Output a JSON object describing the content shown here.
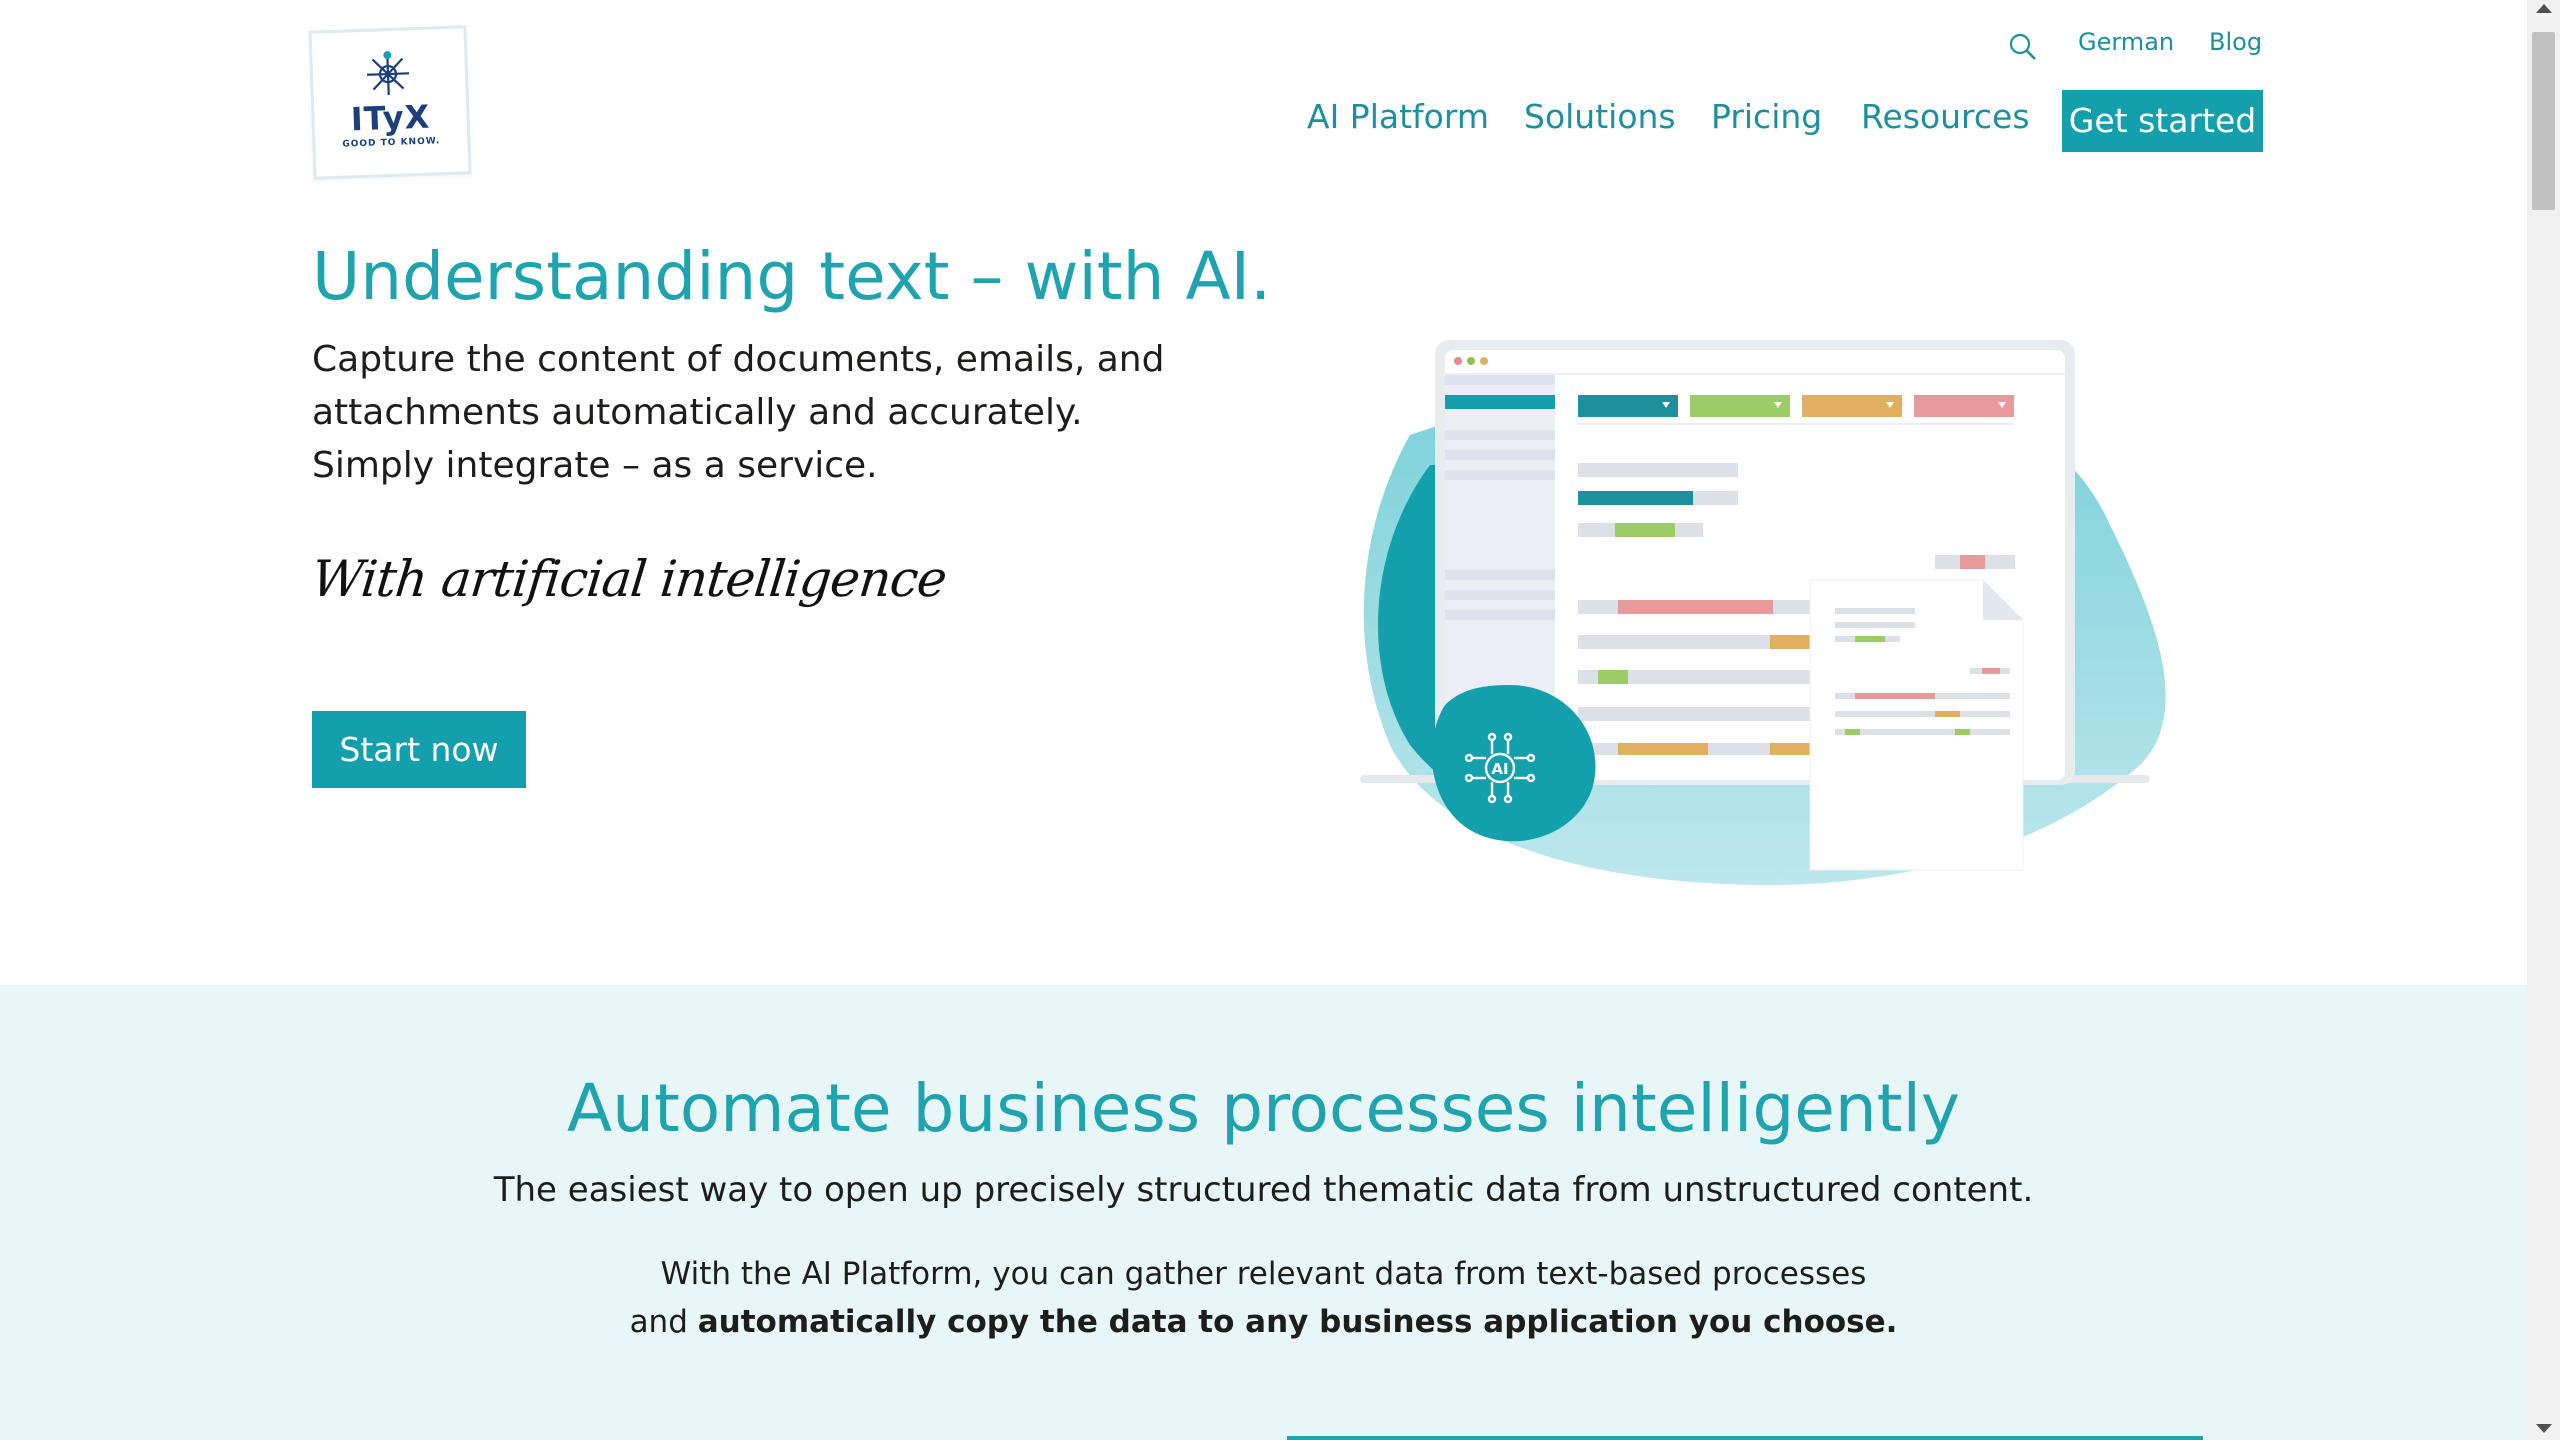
{
  "logo": {
    "wordmark": "ITyX",
    "tagline": "GOOD TO KNOW."
  },
  "top_links": {
    "language": "German",
    "blog": "Blog"
  },
  "nav": {
    "items": [
      "AI Platform",
      "Solutions",
      "Pricing",
      "Resources"
    ],
    "cta": "Get started"
  },
  "hero": {
    "title": "Understanding text – with AI.",
    "lines": [
      "Capture the content of documents, emails, and",
      "attachments automatically and accurately.",
      "Simply integrate – as a service."
    ],
    "script": "With artificial intelligence",
    "button": "Start now",
    "badge": "AI"
  },
  "section": {
    "title": "Automate business processes intelligently",
    "subtitle": "The easiest way to open up precisely structured thematic data from unstructured content.",
    "body_line1": "With the AI Platform, you can gather relevant data from text-based processes",
    "body_line2_prefix": "and ",
    "body_line2_bold": "automatically copy the data to any business application you choose."
  },
  "colors": {
    "accent": "#13a0ac",
    "brand_dark": "#1b3f7a",
    "band": "#e8f6f7"
  },
  "icons": {
    "search": "search-icon",
    "logo": "ityx-star-icon",
    "ai": "ai-chip-icon"
  }
}
